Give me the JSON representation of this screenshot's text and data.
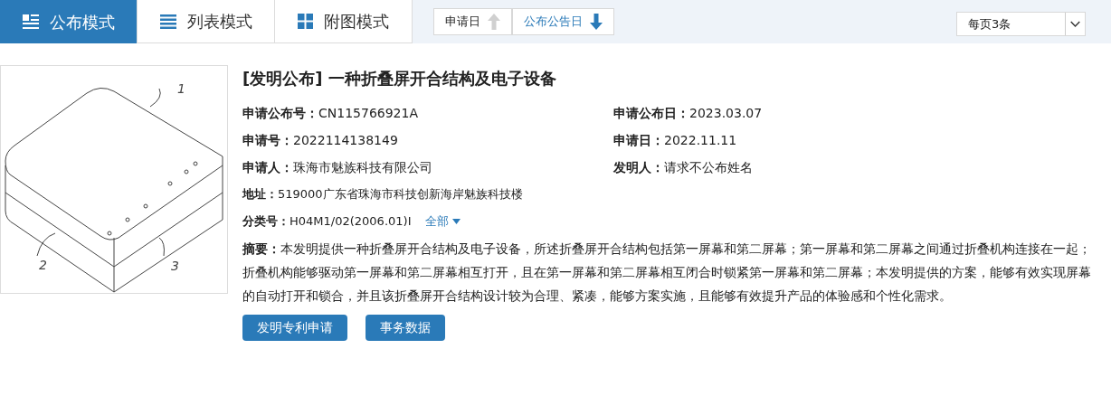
{
  "view_tabs": [
    {
      "label": "公布模式",
      "kind": "detail",
      "selected": true
    },
    {
      "label": "列表模式",
      "kind": "list",
      "selected": false
    },
    {
      "label": "附图模式",
      "kind": "grid",
      "selected": false
    }
  ],
  "sort_buttons": [
    {
      "label": "申请日",
      "kind": "ascending",
      "selected": false
    },
    {
      "label": "公布公告日",
      "kind": "descending",
      "selected": true
    }
  ],
  "page_size_select": {
    "value": "每页3条"
  },
  "result": {
    "title": "[发明公布] 一种折叠屏开合结构及电子设备",
    "fields": [
      {
        "label": "申请公布号：",
        "value": "CN115766921A"
      },
      {
        "label": "申请公布日：",
        "value": "2023.03.07"
      },
      {
        "label": "申请号：",
        "value": "2022114138149"
      },
      {
        "label": "申请日：",
        "value": "2022.11.11"
      },
      {
        "label": "申请人：",
        "value": "珠海市魅族科技有限公司"
      },
      {
        "label": "发明人：",
        "value": "请求不公布姓名"
      }
    ],
    "address": {
      "label": "地址：",
      "value": "519000广东省珠海市科技创新海岸魅族科技楼"
    },
    "classification": {
      "label": "分类号：",
      "value": "H04M1/02(2006.01)I",
      "link": "全部"
    },
    "abstract": {
      "label": "摘要：",
      "text": "本发明提供一种折叠屏开合结构及电子设备，所述折叠屏开合结构包括第一屏幕和第二屏幕；第一屏幕和第二屏幕之间通过折叠机构连接在一起；折叠机构能够驱动第一屏幕和第二屏幕相互打开，且在第一屏幕和第二屏幕相互闭合时锁紧第一屏幕和第二屏幕；本发明提供的方案，能够有效实现屏幕的自动打开和锁合，并且该折叠屏开合结构设计较为合理、紧凑，能够方案实施，且能够有效提升产品的体验感和个性化需求。"
    },
    "buttons": [
      "发明专利申请",
      "事务数据"
    ],
    "drawing_labels": [
      "1",
      "2",
      "3"
    ]
  }
}
